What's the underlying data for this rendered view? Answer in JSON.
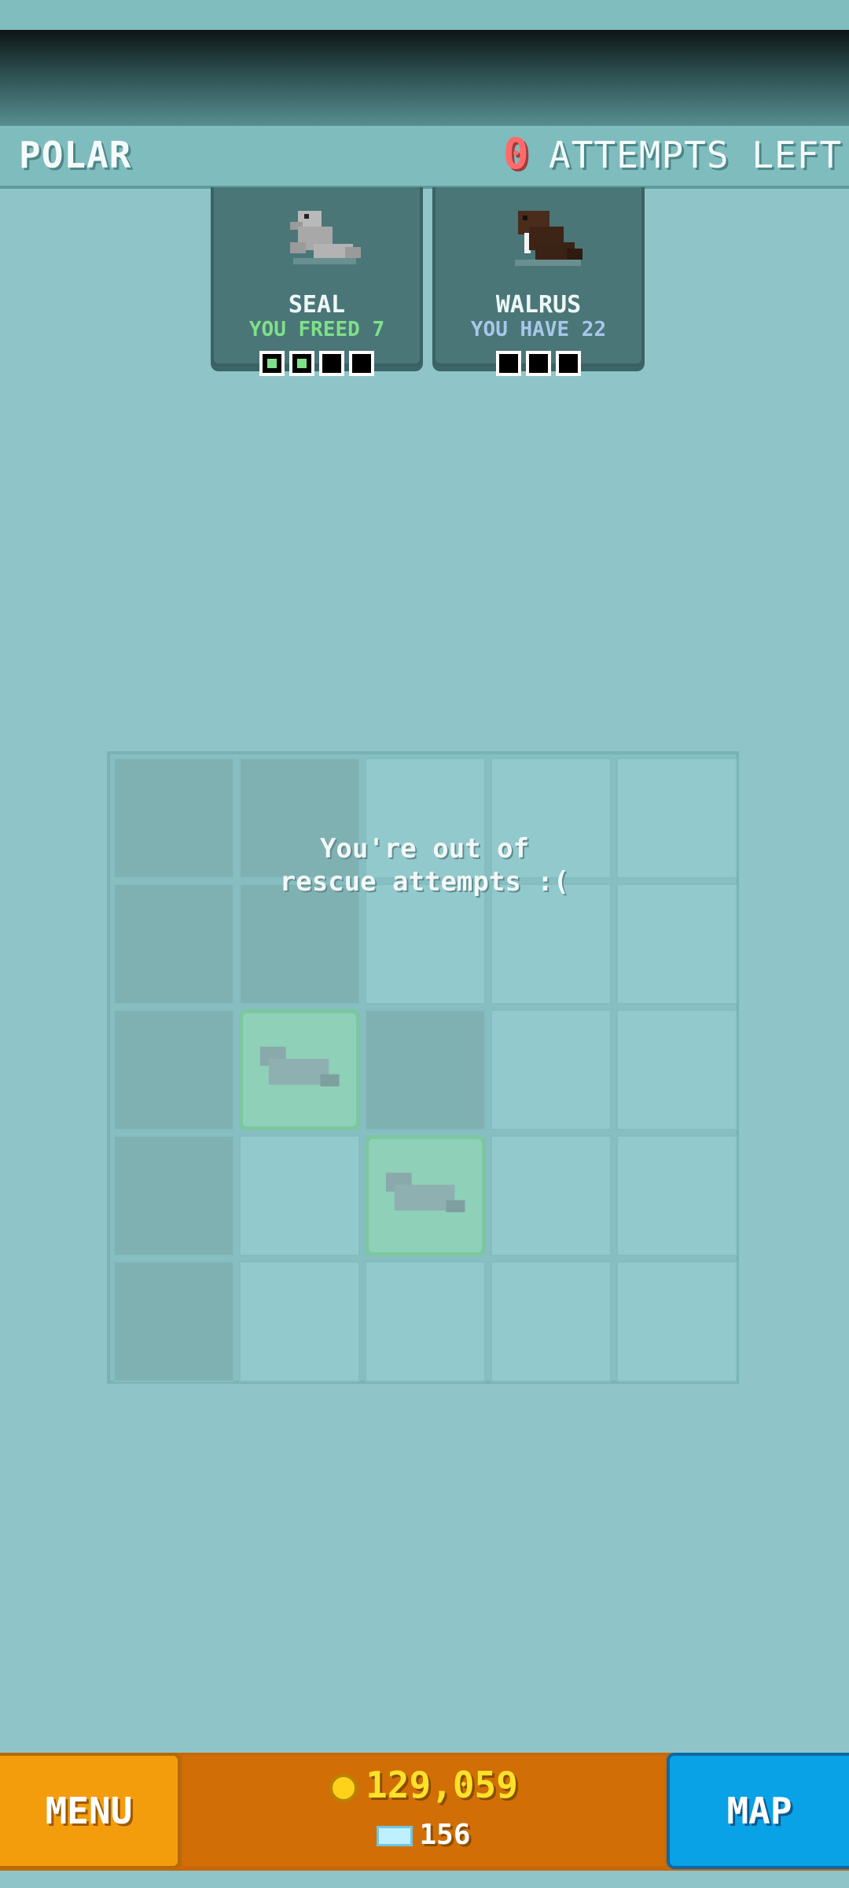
{
  "header": {
    "region": "POLAR",
    "attempts_count": "0",
    "attempts_label": "ATTEMPTS LEFT"
  },
  "cards": [
    {
      "name": "SEAL",
      "status": "YOU FREED 7",
      "progress_total": 4,
      "progress_filled": 2
    },
    {
      "name": "WALRUS",
      "status": "YOU HAVE 22",
      "progress_total": 3,
      "progress_filled": 0
    }
  ],
  "board": {
    "message_line1": "You're out of",
    "message_line2": "rescue attempts :("
  },
  "bottom": {
    "menu_label": "MENU",
    "coins": "129,059",
    "gems": "156",
    "map_label": "MAP"
  }
}
